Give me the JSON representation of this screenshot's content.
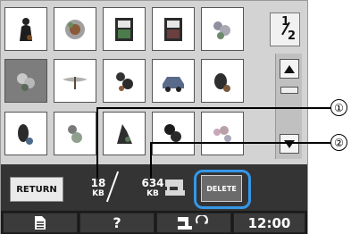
{
  "pattern_grid": {
    "icon_names": [
      "girl-silhouette-pattern-icon",
      "round-flower-pattern-icon",
      "frame-embroidery-pattern-icon",
      "frame-embroidery-pattern-icon",
      "floral-spray-pattern-icon",
      "floral-bouquet-pattern-icon",
      "dragonfly-pattern-icon",
      "animal-cluster-pattern-icon",
      "car-pattern-icon",
      "bird-pattern-icon",
      "flower-figure-pattern-icon",
      "floral-cluster-pattern-icon",
      "rider-pattern-icon",
      "butterfly-pattern-icon",
      "floral-spray-pattern-icon"
    ],
    "selected_index": 5
  },
  "page_indicator": {
    "current": "1",
    "total": "2"
  },
  "scroll": {
    "up_icon": "triangle-up-icon",
    "down_icon": "triangle-down-icon"
  },
  "action_bar": {
    "return_label": "RETURN",
    "pattern_size": "18",
    "pattern_size_unit": "KB",
    "memory_size": "634",
    "memory_size_unit": "KB",
    "delete_label": "DELETE"
  },
  "bottom_bar": {
    "page_icon": "document-icon",
    "help_label": "?",
    "machine_icon": "embroidery-machine-icon",
    "time": "12:00"
  },
  "callouts": [
    "①",
    "②"
  ],
  "colors": {
    "highlight": "#3597e8",
    "bar_dark": "#343434",
    "selected_cell": "#7d7d7d"
  }
}
